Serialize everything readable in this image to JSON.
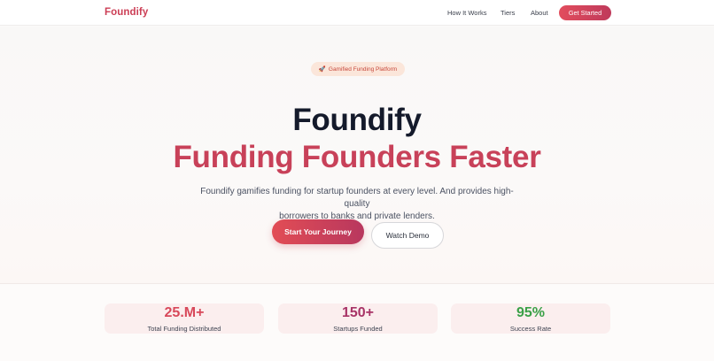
{
  "nav": {
    "brand": "Foundify",
    "links": [
      "How It Works",
      "Tiers",
      "About"
    ],
    "cta": "Get Started"
  },
  "hero": {
    "badge_icon": "rocket-icon",
    "badge_emoji": "🚀",
    "badge_text": "Gamified Funding Platform",
    "title": "Foundify",
    "subtitle": "Funding Founders Faster",
    "description_line1": "Foundify gamifies funding for startup founders at every level. And provides high-quality",
    "description_line2": "borrowers to banks and private lenders.",
    "primary_button": "Start Your Journey",
    "secondary_button": "Watch Demo"
  },
  "stats": [
    {
      "value": "25.M+",
      "label": "Total Funding Distributed",
      "color": "#d8485a"
    },
    {
      "value": "150+",
      "label": "Startups Funded",
      "color": "#a83467"
    },
    {
      "value": "95%",
      "label": "Success Rate",
      "color": "#3aa047"
    }
  ],
  "colors": {
    "brand": "#cc3e55",
    "accent_gradient_start": "#e24d55",
    "accent_gradient_end": "#b8375e"
  }
}
